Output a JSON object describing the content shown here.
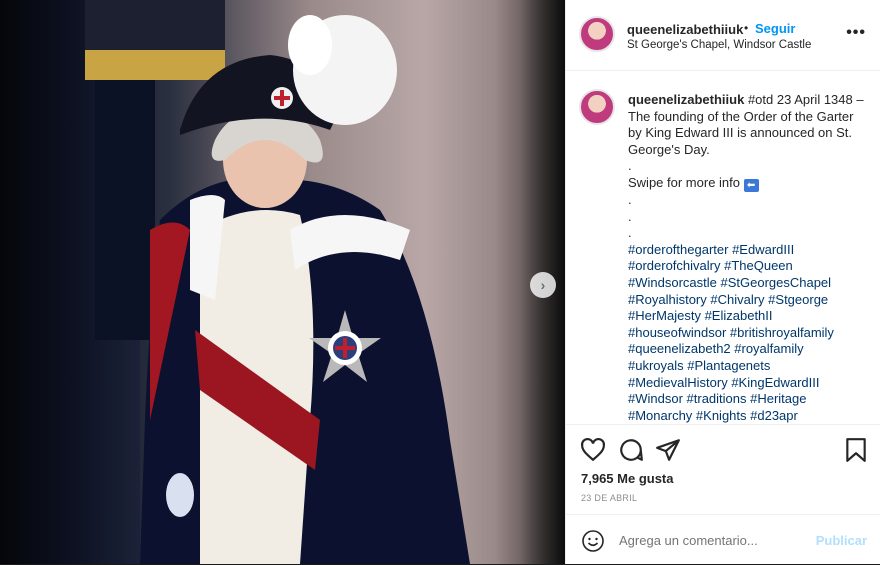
{
  "photo": {
    "alt_description": ""
  },
  "post": {
    "username": "queenelizabethiiuk",
    "separator": "•",
    "follow_label": "Seguir",
    "location": "St George's Chapel, Windsor Castle",
    "more_label": "•••",
    "caption_text": "#otd 23 April 1348 – The founding of the Order of the Garter by King Edward III is announced on St. George's Day.",
    "caption_dot": ".",
    "caption_swipe": "Swipe for more info",
    "caption_arrow": "⬅",
    "hashtags": [
      "#orderofthegarter #EdwardIII",
      "#orderofchivalry #TheQueen",
      "#Windsorcastle #StGeorgesChapel",
      "#Royalhistory #Chivalry #Stgeorge",
      "#HerMajesty #ElizabethII",
      "#houseofwindsor #britishroyalfamily",
      "#queenelizabeth2 #royalfamily",
      "#ukroyals #Plantagenets",
      "#MedievalHistory #KingEdwardIII",
      "#Windsor #traditions #Heritage",
      "#Monarchy #Knights #d23apr"
    ],
    "likes": "7,965 Me gusta",
    "date": "23 DE ABRIL",
    "comment_placeholder": "Agrega un comentario...",
    "publish_label": "Publicar",
    "next_label": "›"
  },
  "colors": {
    "link_blue": "#0095f6",
    "hashtag_blue": "#00376b",
    "publish_disabled": "#b2dffc"
  },
  "icons": [
    "heart-icon",
    "comment-icon",
    "share-icon",
    "bookmark-icon",
    "emoji-icon",
    "chevron-right-icon"
  ]
}
